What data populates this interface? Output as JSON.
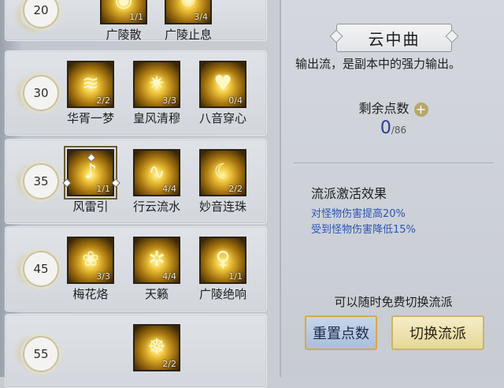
{
  "tiers": [
    {
      "level": "20",
      "skills": [
        {
          "name": "广陵散",
          "count": "1/1",
          "icon": "spinning-gold-disc-icon"
        },
        {
          "name": "广陵止息",
          "count": "3/4",
          "icon": "gold-swirl-icon"
        }
      ]
    },
    {
      "level": "30",
      "skills": [
        {
          "name": "华胥一梦",
          "count": "2/2",
          "icon": "gold-wave-icon"
        },
        {
          "name": "皇风清穆",
          "count": "3/3",
          "icon": "gold-vortex-icon"
        },
        {
          "name": "八音穿心",
          "count": "0/4",
          "icon": "gold-heart-icon"
        }
      ]
    },
    {
      "level": "35",
      "skills": [
        {
          "name": "风雷引",
          "count": "1/1",
          "icon": "gold-guqin-icon"
        },
        {
          "name": "行云流水",
          "count": "4/4",
          "icon": "gold-streams-icon"
        },
        {
          "name": "妙音连珠",
          "count": "2/2",
          "icon": "gold-crescent-icon"
        }
      ]
    },
    {
      "level": "45",
      "skills": [
        {
          "name": "梅花烙",
          "count": "3/3",
          "icon": "gold-lotus-icon"
        },
        {
          "name": "天籁",
          "count": "4/4",
          "icon": "gold-bell-icon"
        },
        {
          "name": "广陵绝响",
          "count": "1/1",
          "icon": "gold-figure-icon"
        }
      ]
    },
    {
      "level": "55",
      "skills": [
        {
          "name": "",
          "count": "2/2",
          "icon": "gold-meditation-icon"
        }
      ]
    }
  ],
  "panel": {
    "title": "云中曲",
    "description": "输出流，是副本中的强力输出。",
    "points_label": "剩余点数",
    "points_current": "0",
    "points_max": "/86",
    "effect_title": "流派激活效果",
    "effects": [
      "对怪物伤害提高20%",
      "受到怪物伤害降低15%"
    ],
    "switch_note": "可以随时免费切换流派",
    "reset_button": "重置点数",
    "switch_button": "切换流派"
  },
  "colors": {
    "effect_text": "#2b55b5",
    "points_value": "#2e3b8f",
    "accent_gold": "#d8a84a"
  }
}
